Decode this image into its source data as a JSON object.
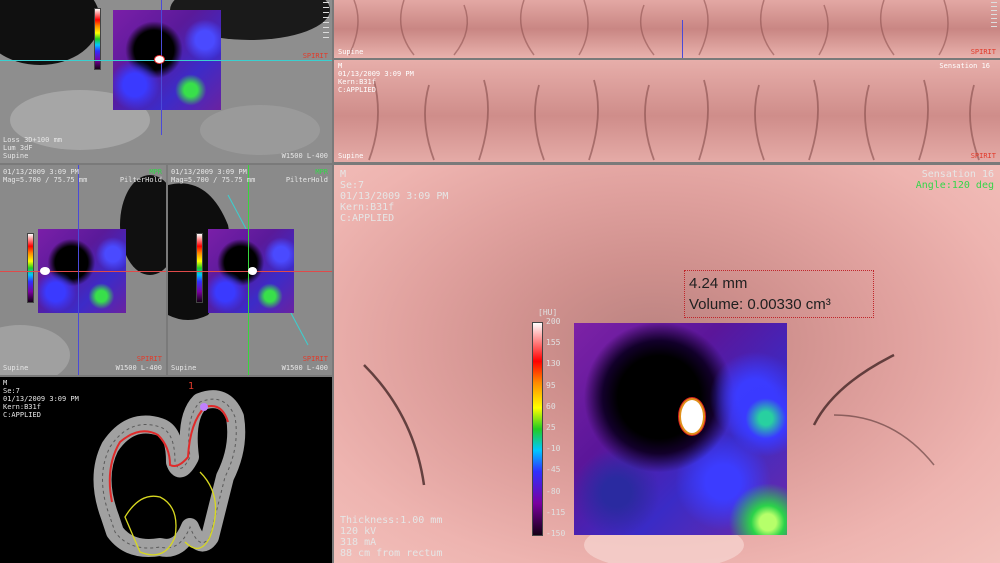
{
  "colors": {
    "accent_green": "#35d64a",
    "accent_red": "#e23b2b",
    "mucosa": "#d9928f"
  },
  "top_left": {
    "info": "Loss 3D+100 mm\nLum 3dF\nSupine",
    "corner": "SPIRIT",
    "window": "W1500 L-400"
  },
  "mid_left": {
    "info": "01/13/2009 3:09 PM\nMag=5.700 / 75.75 mm",
    "tag": "MPR",
    "tag2": "PilterHold",
    "orient": "Supine",
    "corner": "SPIRIT",
    "window": "W1500 L-400"
  },
  "mid_right": {
    "info": "01/13/2009 3:09 PM\nMag=5.700 / 75.75 mm",
    "tag": "MPR",
    "tag2": "PilterHold",
    "orient": "Supine",
    "corner": "SPIRIT",
    "window": "W1500 L-400"
  },
  "overview": {
    "info": "M\nSe:7\n01/13/2009 3:09 PM\nKern:B31f\nC:APPLIED",
    "marker": "1"
  },
  "strip_top": {
    "orient": "Supine",
    "corner": "SPIRIT"
  },
  "strip_bottom": {
    "patient": "M\n01/13/2009 3:09 PM\nKern:B31f\nC:APPLIED",
    "scanner": "Sensation 16",
    "orient": "Supine",
    "corner": "SPIRIT"
  },
  "endo": {
    "info": "M\nSe:7\n01/13/2009 3:09 PM\nKern:B31f\nC:APPLIED",
    "scanner": "Sensation 16",
    "angle": "Angle:120 deg",
    "acq": "Thickness:1.00 mm\n120 kV\n318 mA\n88 cm from rectum",
    "measure_size": "4.24 mm",
    "measure_volume": "Volume: 0.00330 cm³",
    "scale_unit": "[HU]",
    "scale_ticks": [
      "200",
      "155",
      "130",
      "95",
      "60",
      "25",
      "-10",
      "-45",
      "-80",
      "-115",
      "-150"
    ]
  }
}
